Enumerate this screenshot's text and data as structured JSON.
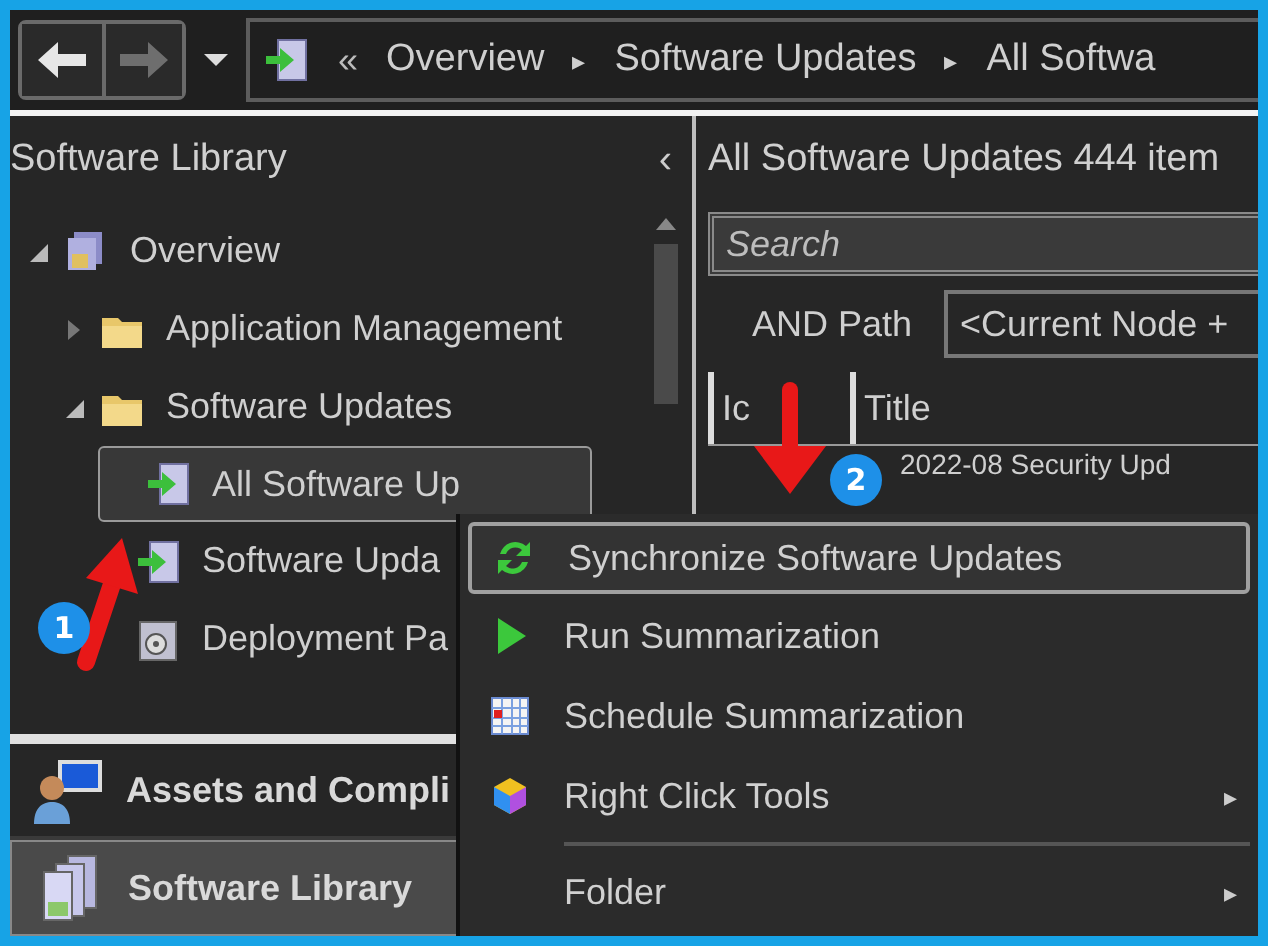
{
  "breadcrumb": {
    "overflow": "«",
    "separator": "▸",
    "items": [
      "Overview",
      "Software Updates",
      "All Softwa"
    ]
  },
  "nav_pane": {
    "title": "Software Library",
    "collapse": "‹",
    "tree": [
      {
        "label": "Overview",
        "kind": "overview",
        "expanded": true,
        "selected": false,
        "children": [
          {
            "label": "Application Management",
            "kind": "folder",
            "expanded": false,
            "selected": false
          },
          {
            "label": "Software Updates",
            "kind": "folder",
            "expanded": true,
            "selected": false,
            "children": [
              {
                "label": "All Software Up",
                "kind": "updates",
                "selected": true
              },
              {
                "label": "Software Upda",
                "kind": "updates",
                "selected": false
              },
              {
                "label": "Deployment Pa",
                "kind": "package",
                "selected": false
              }
            ]
          }
        ]
      }
    ],
    "workspaces": [
      {
        "label": "Assets and Compli",
        "kind": "assets",
        "selected": false
      },
      {
        "label": "Software Library",
        "kind": "library",
        "selected": true
      }
    ]
  },
  "list_pane": {
    "title": "All Software Updates 444 item",
    "search": {
      "placeholder": "Search"
    },
    "filter_label": "AND Path",
    "filter_value": "<Current Node +",
    "columns": [
      "Ic",
      "Title"
    ],
    "rows": [
      {
        "title": "2022-08 Security Upd"
      }
    ]
  },
  "context_menu": [
    {
      "kind": "sync",
      "label": "Synchronize Software Updates",
      "selected": true,
      "submenu": false
    },
    {
      "kind": "run",
      "label": "Run Summarization",
      "selected": false,
      "submenu": false
    },
    {
      "kind": "schedule",
      "label": "Schedule Summarization",
      "selected": false,
      "submenu": false
    },
    {
      "kind": "tools",
      "label": "Right Click Tools",
      "selected": false,
      "submenu": true
    },
    {
      "kind": "separator"
    },
    {
      "kind": "plain",
      "label": "Folder",
      "selected": false,
      "submenu": true
    }
  ],
  "submenu_arrow": "▸",
  "annotations": [
    {
      "number": "1"
    },
    {
      "number": "2"
    }
  ]
}
